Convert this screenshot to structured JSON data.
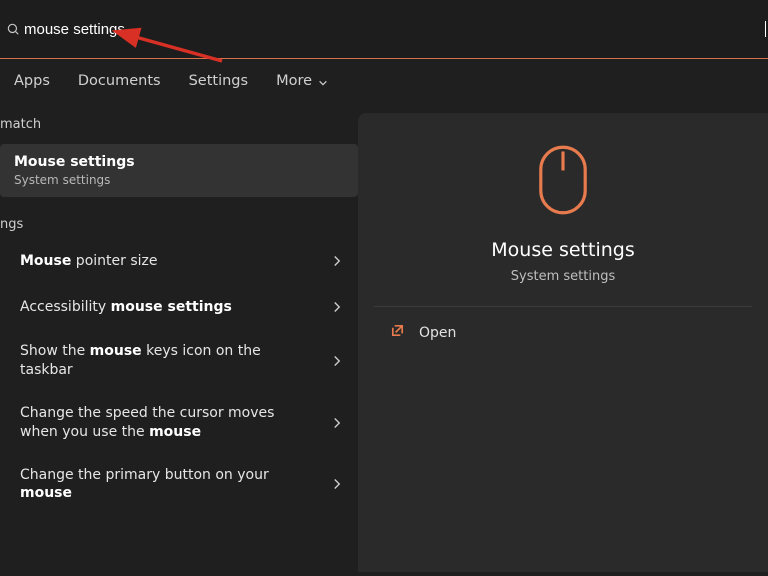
{
  "accent": "#e77b4e",
  "search": {
    "value": "mouse settings"
  },
  "tabs": [
    {
      "label": "Apps"
    },
    {
      "label": "Documents"
    },
    {
      "label": "Settings"
    },
    {
      "label": "More",
      "dropdown": true
    }
  ],
  "left": {
    "group1_label": "match",
    "best": {
      "title": "Mouse settings",
      "subtitle": "System settings"
    },
    "group2_label": "ngs",
    "items": [
      {
        "pre": "",
        "bold": "Mouse",
        "rest": " pointer size"
      },
      {
        "pre": "Accessibility ",
        "bold": "mouse settings",
        "rest": ""
      },
      {
        "pre": "Show the ",
        "bold": "mouse",
        "rest": " keys icon on the taskbar"
      },
      {
        "pre": "Change the speed the cursor moves when you use the ",
        "bold": "mouse",
        "rest": ""
      },
      {
        "pre": "Change the primary button on your ",
        "bold": "mouse",
        "rest": ""
      }
    ]
  },
  "preview": {
    "title": "Mouse settings",
    "subtitle": "System settings"
  },
  "actions": {
    "open": "Open"
  }
}
